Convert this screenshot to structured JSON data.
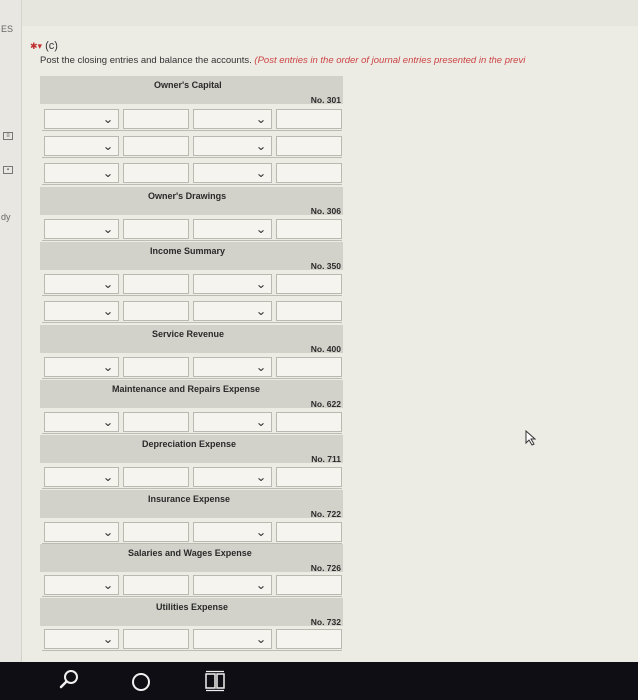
{
  "left_strip": {
    "label_top": "ES",
    "label_mid": "dy"
  },
  "section": {
    "marker": "(c)",
    "instruction": "Post the closing entries and balance the accounts.",
    "instruction_note": "(Post entries in the order of journal entries presented in the previ"
  },
  "accounts": [
    {
      "name": "Owner's Capital",
      "number": "No. 301"
    },
    {
      "name": "Owner's Drawings",
      "number": "No. 306"
    },
    {
      "name": "Income Summary",
      "number": "No. 350"
    },
    {
      "name": "Service Revenue",
      "number": "No. 400"
    },
    {
      "name": "Maintenance and Repairs Expense",
      "number": "No. 622"
    },
    {
      "name": "Depreciation Expense",
      "number": "No. 711"
    },
    {
      "name": "Insurance Expense",
      "number": "No. 722"
    },
    {
      "name": "Salaries and Wages Expense",
      "number": "No. 726"
    },
    {
      "name": "Utilities Expense",
      "number": "No. 732"
    }
  ],
  "icons": {
    "dropdown": "chevron-down-icon",
    "search": "search-icon",
    "cortana": "cortana-icon",
    "taskview": "task-view-icon",
    "cursor": "mouse-cursor-icon"
  },
  "colors": {
    "header_band": "#d2d1ca",
    "field_bg": "#f5f4ef",
    "note_red": "#cc4444",
    "taskbar": "#0e0e14"
  }
}
